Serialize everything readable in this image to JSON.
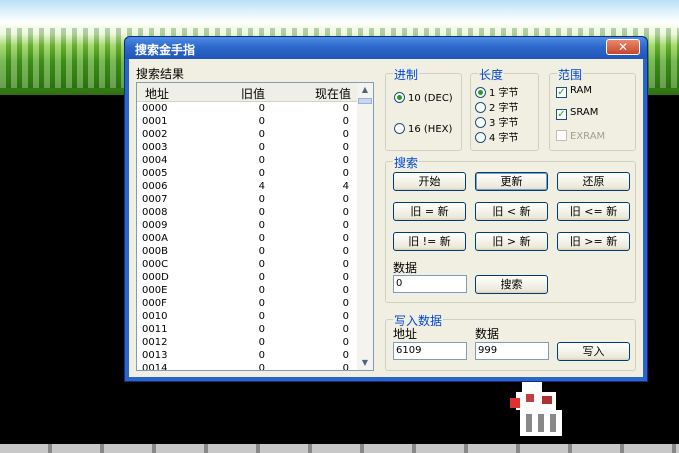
{
  "window": {
    "title": "搜索金手指",
    "close_symbol": "✕"
  },
  "results": {
    "label": "搜索结果",
    "columns": [
      "地址",
      "旧值",
      "现在值"
    ],
    "rows": [
      [
        "0000",
        "0",
        "0"
      ],
      [
        "0001",
        "0",
        "0"
      ],
      [
        "0002",
        "0",
        "0"
      ],
      [
        "0003",
        "0",
        "0"
      ],
      [
        "0004",
        "0",
        "0"
      ],
      [
        "0005",
        "0",
        "0"
      ],
      [
        "0006",
        "4",
        "4"
      ],
      [
        "0007",
        "0",
        "0"
      ],
      [
        "0008",
        "0",
        "0"
      ],
      [
        "0009",
        "0",
        "0"
      ],
      [
        "000A",
        "0",
        "0"
      ],
      [
        "000B",
        "0",
        "0"
      ],
      [
        "000C",
        "0",
        "0"
      ],
      [
        "000D",
        "0",
        "0"
      ],
      [
        "000E",
        "0",
        "0"
      ],
      [
        "000F",
        "0",
        "0"
      ],
      [
        "0010",
        "0",
        "0"
      ],
      [
        "0011",
        "0",
        "0"
      ],
      [
        "0012",
        "0",
        "0"
      ],
      [
        "0013",
        "0",
        "0"
      ],
      [
        "0014",
        "0",
        "0"
      ]
    ]
  },
  "base": {
    "title": "进制",
    "options": [
      "10 (DEC)",
      "16 (HEX)"
    ],
    "selected": 0
  },
  "length": {
    "title": "长度",
    "options": [
      "1 字节",
      "2 字节",
      "3 字节",
      "4 字节"
    ],
    "selected": 0
  },
  "range": {
    "title": "范围",
    "options": [
      {
        "label": "RAM",
        "checked": true,
        "enabled": true
      },
      {
        "label": "SRAM",
        "checked": true,
        "enabled": true
      },
      {
        "label": "EXRAM",
        "checked": false,
        "enabled": false
      }
    ]
  },
  "search": {
    "title": "搜索",
    "buttons": [
      "开始",
      "更新",
      "还原",
      "旧 = 新",
      "旧 < 新",
      "旧 <= 新",
      "旧 != 新",
      "旧 > 新",
      "旧 >= 新"
    ],
    "data_label": "数据",
    "data_value": "0",
    "search_button": "搜索"
  },
  "write": {
    "title": "写入数据",
    "address_label": "地址",
    "address_value": "6109",
    "data_label": "数据",
    "data_value": "999",
    "write_button": "写入"
  },
  "colors": {
    "titlebar": "#2d68cb",
    "group_title": "#0046d5",
    "face": "#f1efe2"
  }
}
